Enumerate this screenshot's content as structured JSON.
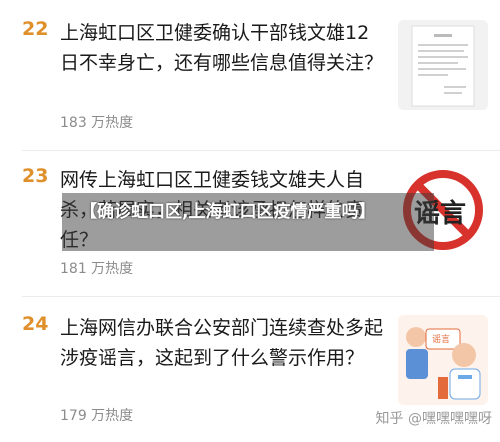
{
  "items": [
    {
      "rank": "22",
      "title": "上海虹口区卫健委确认干部钱文雄12 日不幸身亡，还有哪些信息值得关注？",
      "heat": "183 万热度",
      "thumb_icon": "document-thumbnail-icon"
    },
    {
      "rank": "23",
      "title": "网传上海虹口区卫健委钱文雄夫人自杀，若属实，相关者该承担怎样的责任？",
      "heat": "181 万热度",
      "thumb_icon": "rumor-ban-thumbnail-icon",
      "thumb_text": "谣言"
    },
    {
      "rank": "24",
      "title": "上海网信办联合公安部门连续查处多起涉疫谣言，这起到了什么警示作用？",
      "heat": "179 万热度",
      "thumb_icon": "doctor-rumor-thumbnail-icon",
      "thumb_text": "谣言"
    }
  ],
  "overlay_caption": "【确诊虹口区,上海虹口区疫情严重吗】",
  "watermark": "知乎 @嘿嘿嘿嘿呀",
  "colors": {
    "rank": "#e0902b",
    "title": "#1a1a1a",
    "heat": "#8c8c8c",
    "ban": "#d8322c"
  }
}
